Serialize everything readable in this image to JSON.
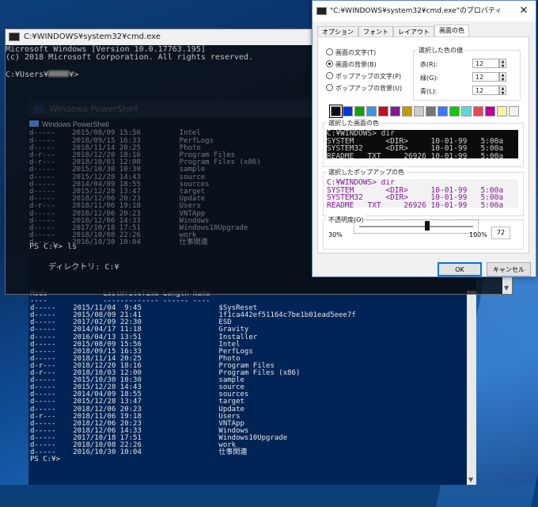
{
  "powershell": {
    "title": "Windows PowerShell",
    "header_mode": "Mode",
    "header_lwt": "LastWriteTime",
    "header_length": "Length",
    "header_name": "Name",
    "underline_mode": "----",
    "underline_lwt": "-------------",
    "underline_length": "------",
    "underline_name": "----",
    "rows": [
      {
        "mode": "d-----",
        "date": "2015/11/04",
        "time": "9:45",
        "name": "$SysReset"
      },
      {
        "mode": "d-----",
        "date": "2015/08/09",
        "time": "21:41",
        "name": "1f1ca442ef51164c7be1b01ead5eee7f"
      },
      {
        "mode": "d-----",
        "date": "2017/02/09",
        "time": "22:30",
        "name": "ESD"
      },
      {
        "mode": "d-----",
        "date": "2014/04/17",
        "time": "11:18",
        "name": "Gravity"
      },
      {
        "mode": "d-----",
        "date": "2016/04/13",
        "time": "13:51",
        "name": "Installer"
      },
      {
        "mode": "d-----",
        "date": "2015/08/09",
        "time": "15:56",
        "name": "Intel"
      },
      {
        "mode": "d-----",
        "date": "2018/09/15",
        "time": "16:33",
        "name": "PerfLogs"
      },
      {
        "mode": "d-----",
        "date": "2018/11/14",
        "time": "20:25",
        "name": "Photo"
      },
      {
        "mode": "d-r---",
        "date": "2018/12/20",
        "time": "18:16",
        "name": "Program Files"
      },
      {
        "mode": "d-r---",
        "date": "2018/10/03",
        "time": "12:00",
        "name": "Program Files (x86)"
      },
      {
        "mode": "d-----",
        "date": "2015/10/30",
        "time": "10:30",
        "name": "sample"
      },
      {
        "mode": "d-----",
        "date": "2015/12/28",
        "time": "14:43",
        "name": "source"
      },
      {
        "mode": "d-----",
        "date": "2014/04/09",
        "time": "18:55",
        "name": "sources"
      },
      {
        "mode": "d-----",
        "date": "2015/12/28",
        "time": "13:47",
        "name": "target"
      },
      {
        "mode": "d-----",
        "date": "2018/12/06",
        "time": "20:23",
        "name": "Update"
      },
      {
        "mode": "d-r---",
        "date": "2018/11/06",
        "time": "19:18",
        "name": "Users"
      },
      {
        "mode": "d-----",
        "date": "2018/12/06",
        "time": "20:23",
        "name": "VNTApp"
      },
      {
        "mode": "d-----",
        "date": "2018/12/06",
        "time": "14:33",
        "name": "Windows"
      },
      {
        "mode": "d-----",
        "date": "2017/10/18",
        "time": "17:51",
        "name": "Windows10Upgrade"
      },
      {
        "mode": "d-----",
        "date": "2018/10/08",
        "time": "22:26",
        "name": "work"
      },
      {
        "mode": "d-----",
        "date": "2016/10/30",
        "time": "10:04",
        "name": "仕事関連"
      }
    ],
    "prompt": "PS C:¥>"
  },
  "cmd": {
    "title": "C:¥WINDOWS¥system32¥cmd.exe",
    "banner_1": "Microsoft Windows [Version 10.0.17763.195]",
    "banner_2": "(c) 2018 Microsoft Corporation. All rights reserved.",
    "prompt": "C:¥Users¥",
    "prompt_tail": "¥>",
    "ghost_rows": [
      {
        "mode": "d-----",
        "date": "2015/08/09",
        "time": "15:56",
        "name": "Intel"
      },
      {
        "mode": "d-----",
        "date": "2018/09/15",
        "time": "16:33",
        "name": "PerfLogs"
      },
      {
        "mode": "d-----",
        "date": "2018/11/14",
        "time": "20:25",
        "name": "Photo"
      },
      {
        "mode": "d-r---",
        "date": "2018/12/20",
        "time": "18:16",
        "name": "Program Files"
      },
      {
        "mode": "d-r---",
        "date": "2018/10/03",
        "time": "12:00",
        "name": "Program Files (x86)"
      },
      {
        "mode": "d-----",
        "date": "2015/10/30",
        "time": "10:30",
        "name": "sample"
      },
      {
        "mode": "d-----",
        "date": "2015/12/28",
        "time": "14:43",
        "name": "source"
      },
      {
        "mode": "d-----",
        "date": "2014/04/09",
        "time": "18:55",
        "name": "sources"
      },
      {
        "mode": "d-----",
        "date": "2015/12/28",
        "time": "13:47",
        "name": "target"
      },
      {
        "mode": "d-----",
        "date": "2018/12/06",
        "time": "20:23",
        "name": "Update"
      },
      {
        "mode": "d-r---",
        "date": "2018/11/06",
        "time": "19:18",
        "name": "Users"
      },
      {
        "mode": "d-----",
        "date": "2018/12/06",
        "time": "20:23",
        "name": "VNTApp"
      },
      {
        "mode": "d-----",
        "date": "2018/12/06",
        "time": "14:33",
        "name": "Windows"
      },
      {
        "mode": "d-----",
        "date": "2017/10/18",
        "time": "17:51",
        "name": "Windows10Upgrade"
      },
      {
        "mode": "d-----",
        "date": "2018/10/08",
        "time": "22:26",
        "name": "work"
      },
      {
        "mode": "d-----",
        "date": "2016/10/30",
        "time": "10:04",
        "name": "仕事関連"
      }
    ],
    "ps_ls": "PS C:¥> ls",
    "directory_line": "ディレクトリ: C:¥"
  },
  "dialog": {
    "title": "\"C:¥WINDOWS¥system32¥cmd.exe\"のプロパティ",
    "close_glyph": "✕",
    "tabs": [
      "オプション",
      "フォント",
      "レイアウト",
      "画面の色"
    ],
    "active_tab_index": 3,
    "radios": [
      {
        "label": "画面の文字(T)",
        "selected": false
      },
      {
        "label": "画面の背景(B)",
        "selected": true
      },
      {
        "label": "ポップアップの文字(P)",
        "selected": false
      },
      {
        "label": "ポップアップの背景(U)",
        "selected": false
      }
    ],
    "color_values_label": "選択した色の値",
    "red_label": "赤(R):",
    "red_value": "12",
    "green_label": "緑(G):",
    "green_value": "12",
    "blue_label": "青(L):",
    "blue_value": "12",
    "palette": [
      "#0c0c0c",
      "#0037da",
      "#13a10e",
      "#3a96dd",
      "#c50f1f",
      "#881798",
      "#c19c00",
      "#cccccc",
      "#767676",
      "#3b78ff",
      "#16c60c",
      "#61d6d6",
      "#e74856",
      "#b4009e",
      "#f9f1a5",
      "#f2f2f2"
    ],
    "selected_swatch_index": 0,
    "screen_preview_label": "選択した画面の色",
    "popup_preview_label": "選択したポップアップの色",
    "preview_lines": [
      "C:¥WINDOWS> dir",
      "SYSTEM       <DIR>     10-01-99   5:00a",
      "SYSTEM32     <DIR>     10-01-99   5:00a",
      "README   TXT     26926 10-01-99   5:00a"
    ],
    "screen_text_color": "#cccccc",
    "screen_bg_color": "#0c0c0c",
    "popup_text_color": "#881798",
    "popup_bg_color": "#f2f2f2",
    "opacity_label": "不透明度(O)",
    "opacity_min": "30%",
    "opacity_max": "100%",
    "opacity_value": "72",
    "ok_label": "OK",
    "cancel_label": "キャンセル"
  }
}
